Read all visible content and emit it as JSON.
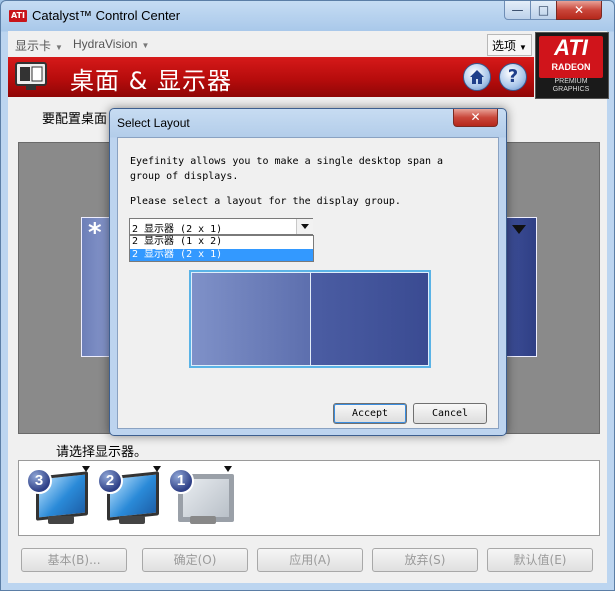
{
  "window": {
    "app_logo": "ATI",
    "title": "Catalyst™ Control Center",
    "min": "—",
    "max": "□",
    "close": "✕"
  },
  "menubar": {
    "items": [
      {
        "label": "显示卡",
        "arrow": "▼"
      },
      {
        "label": "HydraVision",
        "arrow": "▼"
      }
    ],
    "options": {
      "label": "选项",
      "arrow": "▼"
    }
  },
  "banner": {
    "title": "桌面 & 显示器",
    "help": "?"
  },
  "brand": {
    "logo": "ATI",
    "sub": "RADEON",
    "tag": "PREMIUM GRAPHICS",
    "red": "#d0141b"
  },
  "main": {
    "section_label": "要配置桌面",
    "asterisk": "*",
    "select_display_label": "请选择显示器。",
    "monitors": [
      {
        "badge": "3",
        "icon": "lcd-monitor-icon"
      },
      {
        "badge": "2",
        "icon": "lcd-monitor-icon"
      },
      {
        "badge": "1",
        "icon": "crt-monitor-icon"
      }
    ]
  },
  "bottom_buttons": [
    "基本(B)...",
    "确定(O)",
    "应用(A)",
    "放弃(S)",
    "默认值(E)"
  ],
  "dialog": {
    "title": "Select Layout",
    "close": "✕",
    "description": "Eyefinity allows you to make a single desktop span a group of displays.",
    "prompt": "Please select a layout for the display group.",
    "selected": "2 显示器 (2 x 1)",
    "options": [
      "2 显示器 (1 x 2)",
      "2 显示器 (2 x 1)"
    ],
    "accept": "Accept",
    "cancel": "Cancel",
    "highlight": "#3399ff"
  }
}
